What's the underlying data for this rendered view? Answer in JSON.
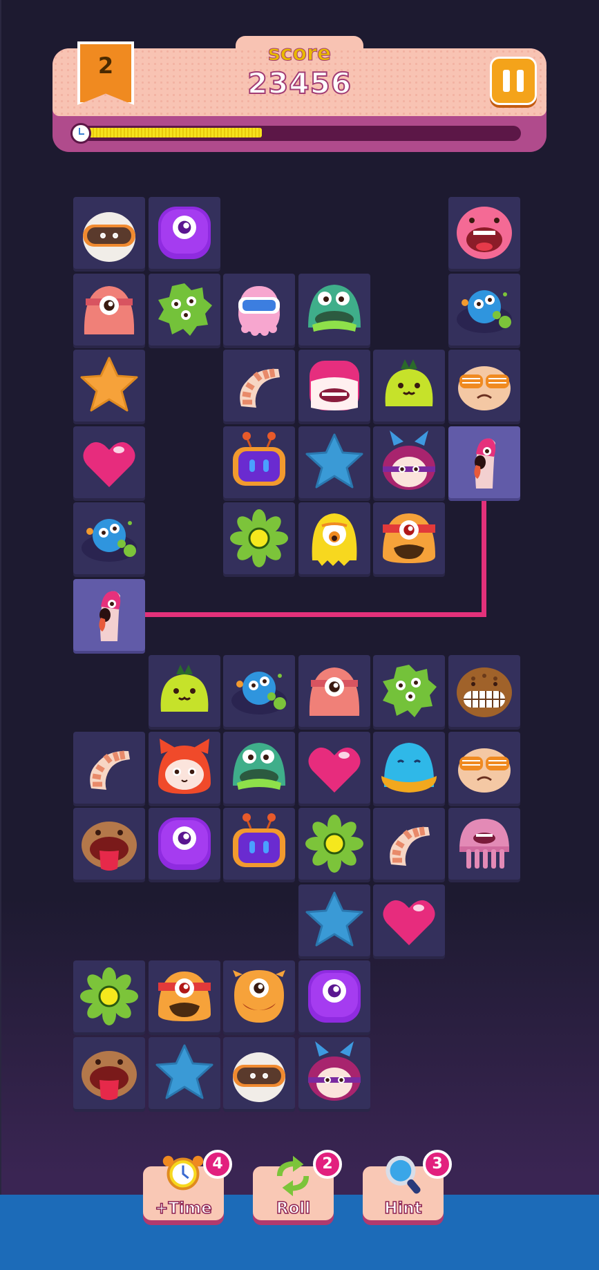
{
  "header": {
    "score_label": "score",
    "score_value": "23456",
    "level": "2"
  },
  "timer": {
    "fraction_remaining": 0.42
  },
  "colors": {
    "background": "#1d1a30",
    "tile": "#34305c",
    "tile_selected": "#615ba8",
    "path": "#e3317a",
    "accent": "#f4a31a"
  },
  "board": {
    "columns": 6,
    "rows": 12,
    "tiles": [
      {
        "r": 0,
        "c": 0,
        "icon": "astronaut-monster-icon"
      },
      {
        "r": 0,
        "c": 1,
        "icon": "purple-cyclops-blob-icon"
      },
      {
        "r": 0,
        "c": 5,
        "icon": "pink-shouting-blob-icon"
      },
      {
        "r": 1,
        "c": 0,
        "icon": "pink-cyclops-headband-icon"
      },
      {
        "r": 1,
        "c": 1,
        "icon": "green-germ-icon"
      },
      {
        "r": 1,
        "c": 2,
        "icon": "pink-goggle-octopus-icon"
      },
      {
        "r": 1,
        "c": 3,
        "icon": "teal-zombie-blob-icon"
      },
      {
        "r": 1,
        "c": 5,
        "icon": "blue-bubble-germ-icon"
      },
      {
        "r": 2,
        "c": 0,
        "icon": "orange-star-icon"
      },
      {
        "r": 2,
        "c": 2,
        "icon": "shrimp-icon"
      },
      {
        "r": 2,
        "c": 3,
        "icon": "pink-furry-monster-icon"
      },
      {
        "r": 2,
        "c": 4,
        "icon": "lime-sprout-blob-icon"
      },
      {
        "r": 2,
        "c": 5,
        "icon": "sunglasses-face-icon"
      },
      {
        "r": 3,
        "c": 0,
        "icon": "pink-heart-icon"
      },
      {
        "r": 3,
        "c": 2,
        "icon": "tv-robot-icon"
      },
      {
        "r": 3,
        "c": 3,
        "icon": "blue-star-icon"
      },
      {
        "r": 3,
        "c": 4,
        "icon": "purple-bunny-hood-icon"
      },
      {
        "r": 3,
        "c": 5,
        "icon": "pink-worm-icon",
        "selected": true
      },
      {
        "r": 4,
        "c": 0,
        "icon": "blue-bubble-germ-icon"
      },
      {
        "r": 4,
        "c": 2,
        "icon": "green-flower-icon"
      },
      {
        "r": 4,
        "c": 3,
        "icon": "yellow-cyclops-icon"
      },
      {
        "r": 4,
        "c": 4,
        "icon": "orange-cyclops-headband-icon"
      },
      {
        "r": 5,
        "c": 0,
        "icon": "pink-worm-icon",
        "selected": true
      },
      {
        "r": 6,
        "c": 1,
        "icon": "lime-sprout-blob-icon"
      },
      {
        "r": 6,
        "c": 2,
        "icon": "blue-bubble-germ-icon"
      },
      {
        "r": 6,
        "c": 3,
        "icon": "pink-cyclops-headband-icon"
      },
      {
        "r": 6,
        "c": 4,
        "icon": "green-germ-icon"
      },
      {
        "r": 6,
        "c": 5,
        "icon": "brown-grin-monster-icon"
      },
      {
        "r": 7,
        "c": 0,
        "icon": "shrimp-icon"
      },
      {
        "r": 7,
        "c": 1,
        "icon": "red-fox-hood-icon"
      },
      {
        "r": 7,
        "c": 2,
        "icon": "teal-zombie-blob-icon"
      },
      {
        "r": 7,
        "c": 3,
        "icon": "pink-heart-icon"
      },
      {
        "r": 7,
        "c": 4,
        "icon": "blue-duck-blob-icon"
      },
      {
        "r": 7,
        "c": 5,
        "icon": "sunglasses-face-icon"
      },
      {
        "r": 8,
        "c": 0,
        "icon": "brown-tongue-monster-icon"
      },
      {
        "r": 8,
        "c": 1,
        "icon": "purple-cyclops-blob-icon"
      },
      {
        "r": 8,
        "c": 2,
        "icon": "tv-robot-icon"
      },
      {
        "r": 8,
        "c": 3,
        "icon": "green-flower-icon"
      },
      {
        "r": 8,
        "c": 4,
        "icon": "shrimp-icon"
      },
      {
        "r": 8,
        "c": 5,
        "icon": "pink-jellyfish-icon"
      },
      {
        "r": 9,
        "c": 3,
        "icon": "blue-star-icon"
      },
      {
        "r": 9,
        "c": 4,
        "icon": "pink-heart-icon"
      },
      {
        "r": 10,
        "c": 0,
        "icon": "green-flower-icon"
      },
      {
        "r": 10,
        "c": 1,
        "icon": "orange-cyclops-headband-icon"
      },
      {
        "r": 10,
        "c": 2,
        "icon": "orange-grin-cyclops-icon"
      },
      {
        "r": 10,
        "c": 3,
        "icon": "purple-cyclops-blob-icon"
      },
      {
        "r": 11,
        "c": 0,
        "icon": "brown-tongue-monster-icon"
      },
      {
        "r": 11,
        "c": 1,
        "icon": "blue-star-icon"
      },
      {
        "r": 11,
        "c": 2,
        "icon": "astronaut-monster-icon"
      },
      {
        "r": 11,
        "c": 3,
        "icon": "purple-bunny-hood-icon"
      }
    ],
    "connection_path": [
      {
        "r": 3,
        "c": 5
      },
      {
        "r": 5,
        "c": 5
      },
      {
        "r": 5,
        "c": 0
      }
    ]
  },
  "powerups": [
    {
      "label": "+Time",
      "count": "4",
      "icon": "alarm-clock-icon"
    },
    {
      "label": "Roll",
      "count": "2",
      "icon": "shuffle-arrows-icon"
    },
    {
      "label": "Hint",
      "count": "3",
      "icon": "magnifier-icon"
    }
  ]
}
